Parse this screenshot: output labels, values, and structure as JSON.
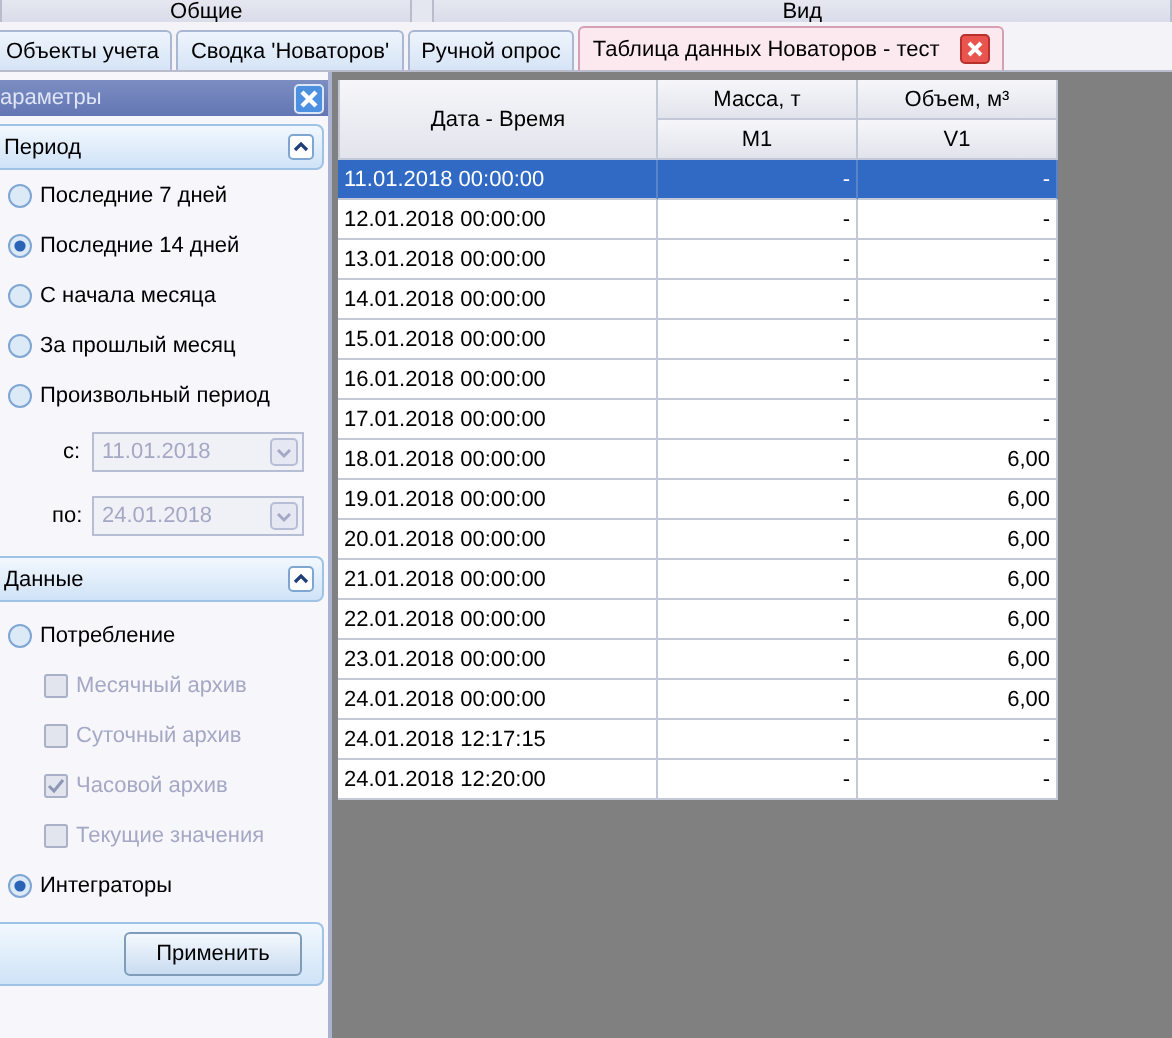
{
  "ribbon_groups": [
    "Общие",
    "Вид"
  ],
  "tabs": [
    {
      "label": "Объекты учета",
      "selected": false,
      "closable": false
    },
    {
      "label": "Сводка 'Новаторов'",
      "selected": false,
      "closable": false
    },
    {
      "label": "Ручной опрос",
      "selected": false,
      "closable": false
    },
    {
      "label": "Таблица данных Новаторов - тест",
      "selected": true,
      "closable": true
    }
  ],
  "panel": {
    "title": "араметры",
    "period": {
      "title": "Период",
      "expanded": true,
      "options": [
        {
          "label": "Последние 7 дней",
          "selected": false
        },
        {
          "label": "Последние 14 дней",
          "selected": true
        },
        {
          "label": "С начала месяца",
          "selected": false
        },
        {
          "label": "За прошлый месяц",
          "selected": false
        },
        {
          "label": "Произвольный период",
          "selected": false
        }
      ],
      "from": {
        "label": "с:",
        "value": "11.01.2018",
        "disabled": true
      },
      "to": {
        "label": "по:",
        "value": "24.01.2018",
        "disabled": true
      }
    },
    "data": {
      "title": "Данные",
      "expanded": true,
      "items": [
        {
          "kind": "radio",
          "label": "Потребление",
          "selected": false
        },
        {
          "kind": "checkbox",
          "label": "Месячный архив",
          "checked": false,
          "disabled": true
        },
        {
          "kind": "checkbox",
          "label": "Суточный архив",
          "checked": false,
          "disabled": true
        },
        {
          "kind": "checkbox",
          "label": "Часовой архив",
          "checked": true,
          "disabled": true
        },
        {
          "kind": "checkbox",
          "label": "Текущие значения",
          "checked": false,
          "disabled": true
        },
        {
          "kind": "radio",
          "label": "Интеграторы",
          "selected": true
        }
      ]
    },
    "apply": "Применить"
  },
  "table": {
    "date_header": "Дата - Время",
    "groups": [
      {
        "title": "Масса, т",
        "sub": "M1"
      },
      {
        "title": "Объем, м³",
        "sub": "V1"
      }
    ],
    "rows": [
      {
        "date": "11.01.2018 00:00:00",
        "m1": "-",
        "v1": "-",
        "selected": true
      },
      {
        "date": "12.01.2018 00:00:00",
        "m1": "-",
        "v1": "-",
        "selected": false
      },
      {
        "date": "13.01.2018 00:00:00",
        "m1": "-",
        "v1": "-",
        "selected": false
      },
      {
        "date": "14.01.2018 00:00:00",
        "m1": "-",
        "v1": "-",
        "selected": false
      },
      {
        "date": "15.01.2018 00:00:00",
        "m1": "-",
        "v1": "-",
        "selected": false
      },
      {
        "date": "16.01.2018 00:00:00",
        "m1": "-",
        "v1": "-",
        "selected": false
      },
      {
        "date": "17.01.2018 00:00:00",
        "m1": "-",
        "v1": "-",
        "selected": false
      },
      {
        "date": "18.01.2018 00:00:00",
        "m1": "-",
        "v1": "6,00",
        "selected": false
      },
      {
        "date": "19.01.2018 00:00:00",
        "m1": "-",
        "v1": "6,00",
        "selected": false
      },
      {
        "date": "20.01.2018 00:00:00",
        "m1": "-",
        "v1": "6,00",
        "selected": false
      },
      {
        "date": "21.01.2018 00:00:00",
        "m1": "-",
        "v1": "6,00",
        "selected": false
      },
      {
        "date": "22.01.2018 00:00:00",
        "m1": "-",
        "v1": "6,00",
        "selected": false
      },
      {
        "date": "23.01.2018 00:00:00",
        "m1": "-",
        "v1": "6,00",
        "selected": false
      },
      {
        "date": "24.01.2018 00:00:00",
        "m1": "-",
        "v1": "6,00",
        "selected": false
      },
      {
        "date": "24.01.2018 12:17:15",
        "m1": "-",
        "v1": "-",
        "selected": false
      },
      {
        "date": "24.01.2018 12:20:00",
        "m1": "-",
        "v1": "-",
        "selected": false
      }
    ]
  }
}
